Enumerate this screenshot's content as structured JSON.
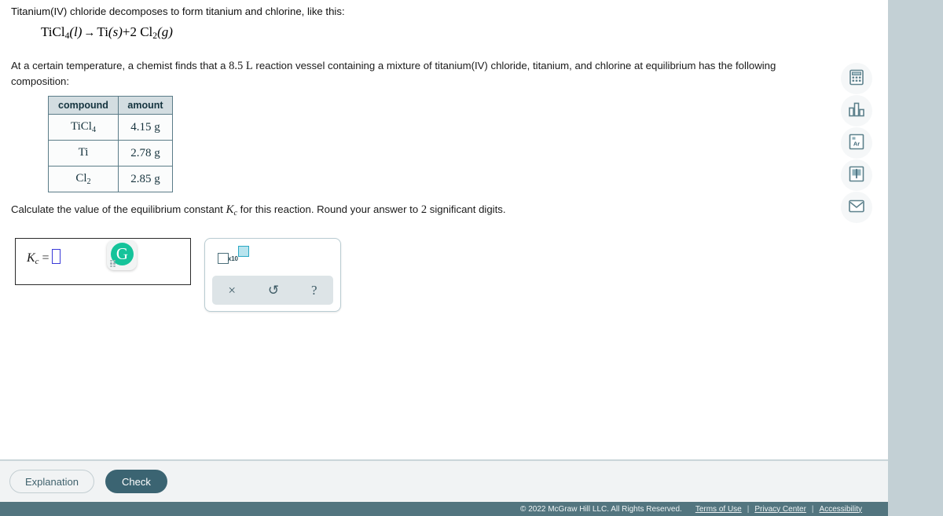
{
  "question": {
    "intro": "Titanium(IV) chloride decomposes to form titanium and chlorine, like this:",
    "equation": {
      "reactant_formula": "TiCl",
      "reactant_sub": "4",
      "reactant_state": "(l)",
      "arrow": "→",
      "product1_formula": "Ti",
      "product1_state": "(s)",
      "plus": "+",
      "product2_coefficient": "2",
      "product2_formula": "Cl",
      "product2_sub": "2",
      "product2_state": "(g)",
      "full_text": "TiCl4(l) → Ti(s) + 2 Cl2(g)"
    },
    "body_part1": "At a certain temperature, a chemist finds that a",
    "volume_value": "8.5",
    "volume_unit": "L",
    "body_part2": "reaction vessel containing a mixture of titanium(IV) chloride, titanium, and chlorine at equilibrium has the following composition:",
    "prompt_part1": "Calculate the value of the equilibrium constant",
    "prompt_symbol": "K",
    "prompt_symbol_sub": "c",
    "prompt_part2": "for this reaction. Round your answer to",
    "prompt_sig_digits": "2",
    "prompt_part3": "significant digits."
  },
  "table": {
    "headers": [
      "compound",
      "amount"
    ],
    "rows": [
      {
        "compound": "TiCl",
        "compound_sub": "4",
        "amount": "4.15 g"
      },
      {
        "compound": "Ti",
        "compound_sub": "",
        "amount": "2.78 g"
      },
      {
        "compound": "Cl",
        "compound_sub": "2",
        "amount": "2.85 g"
      }
    ]
  },
  "answer": {
    "label": "K",
    "label_sub": "c",
    "equals": "=",
    "value": "",
    "placeholder": ""
  },
  "grammarly": {
    "letter": "G",
    "color": "#15c39a",
    "name": "grammarly-assistant"
  },
  "math_panel": {
    "sci_notation_label": "x10",
    "buttons": [
      {
        "name": "clear",
        "glyph": "×"
      },
      {
        "name": "undo",
        "glyph": "↺"
      },
      {
        "name": "help",
        "glyph": "?"
      }
    ]
  },
  "tool_rail": [
    {
      "name": "calculator-icon",
      "label": "Calculator"
    },
    {
      "name": "bar-chart-icon",
      "label": "Data"
    },
    {
      "name": "periodic-table-icon",
      "label": "Ar"
    },
    {
      "name": "reference-book-icon",
      "label": "Reference"
    },
    {
      "name": "message-envelope-icon",
      "label": "Message"
    }
  ],
  "actions": {
    "explanation_label": "Explanation",
    "check_label": "Check"
  },
  "footer": {
    "copyright": "© 2022 McGraw Hill LLC. All Rights Reserved.",
    "links": [
      "Terms of Use",
      "Privacy Center",
      "Accessibility"
    ],
    "separator": "|"
  },
  "colors": {
    "page_background": "#c3d0d5",
    "footer_bar": "#53757f",
    "check_button": "#3b6472",
    "accent_cyan": "#2aa8c4"
  }
}
